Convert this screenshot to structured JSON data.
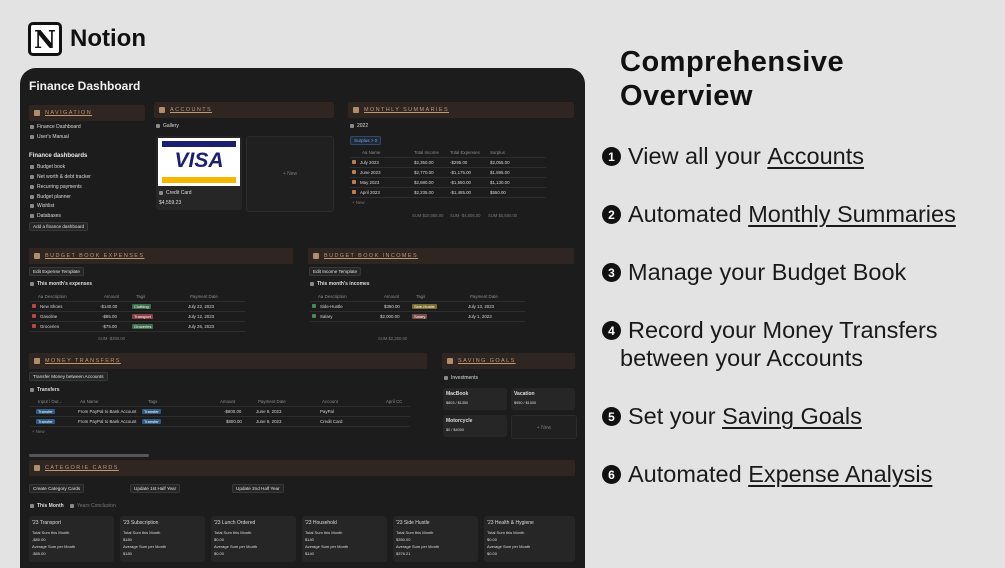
{
  "brand": {
    "logo_letter": "N",
    "name": "Notion"
  },
  "dashboard": {
    "title": "Finance Dashboard",
    "navigation": {
      "header": "NAVIGATION",
      "links": [
        "Finance Dashboard",
        "User's Manual"
      ],
      "group_title": "Finance dashboards",
      "items": [
        "Budget book",
        "Net worth & debt tracker",
        "Recurring payments",
        "Budget planner",
        "Wishlist",
        "Databases"
      ],
      "add_button": "Add a finance dashboard"
    },
    "accounts": {
      "header": "ACCOUNTS",
      "view": "Gallery",
      "card_logo": "VISA",
      "card_name": "Credit Card",
      "card_value": "$4,559.23",
      "new_label": "+ New"
    },
    "monthly": {
      "header": "MONTHLY SUMMARIES",
      "view": "2022",
      "filter": "Surplus > 0",
      "columns": [
        "Aa Name",
        "Total Income",
        "Total Expenses",
        "Surplus"
      ],
      "rows": [
        [
          "July 2023",
          "$2,350.00",
          "-$295.00",
          "$2,055.00"
        ],
        [
          "June 2023",
          "$2,770.00",
          "-$1,175.00",
          "$1,595.00"
        ],
        [
          "May 2023",
          "$2,680.00",
          "-$1,550.00",
          "$1,130.00"
        ],
        [
          "April 2023",
          "$2,235.00",
          "-$1,485.00",
          "$550.00"
        ]
      ],
      "new_label": "+ New",
      "sums": [
        "SUM $10,085.00",
        "SUM -$4,505.00",
        "SUM $5,580.00"
      ]
    },
    "expenses": {
      "header": "BUDGET BOOK EXPENSES",
      "template_button": "Edit Expense Template",
      "view": "This month's expenses",
      "columns": [
        "Aa Description",
        "Amount",
        "Tags",
        "Payment Date"
      ],
      "rows": [
        {
          "desc": "New Shoes",
          "amount": "-$140.00",
          "tag": "Clothing",
          "date": "July 22, 2023"
        },
        {
          "desc": "Gasoline",
          "amount": "-$85.00",
          "tag": "Transport",
          "date": "July 12, 2023"
        },
        {
          "desc": "Groceries",
          "amount": "-$75.00",
          "tag": "Groceries",
          "date": "July 26, 2023"
        }
      ],
      "sum": "SUM -$290.00",
      "tag_colors": [
        "#3d6b4e",
        "#8a4040",
        "#3d6b4e"
      ]
    },
    "incomes": {
      "header": "BUDGET BOOK INCOMES",
      "template_button": "Edit Income Template",
      "view": "This month's incomes",
      "columns": [
        "Aa Description",
        "Amount",
        "Tags",
        "Payment Date"
      ],
      "rows": [
        {
          "desc": "Side-Hustle",
          "amount": "$350.00",
          "tag": "Side-Hustle",
          "date": "July 13, 2023"
        },
        {
          "desc": "Salary",
          "amount": "$2,000.00",
          "tag": "Salary",
          "date": "July 1, 2023"
        }
      ],
      "sum": "SUM $2,350.00",
      "tag_colors": [
        "#7a6a2e",
        "#7a4a4a"
      ]
    },
    "transfers": {
      "header": "MONEY TRANSFERS",
      "button": "Transfer Money between Accounts",
      "view": "Transfers",
      "columns": [
        "Input / Out...",
        "Aa Name",
        "Tags",
        "Amount",
        "Payment Date",
        "Account",
        "April CC"
      ],
      "rows": [
        {
          "type": "Transfer",
          "name": "From PayPal to Bank Account",
          "tag": "Transfer",
          "amount": "-$800.00",
          "date": "June 9, 2023",
          "account": "PayPal"
        },
        {
          "type": "Transfer",
          "name": "From PayPal to Bank Account",
          "tag": "Transfer",
          "amount": "$800.00",
          "date": "June 9, 2023",
          "account": "Credit Card"
        }
      ],
      "new_label": "+ New"
    },
    "saving": {
      "header": "SAVING GOALS",
      "view": "Investments",
      "goals": [
        {
          "name": "MacBook",
          "progress": "$803 / $1350"
        },
        {
          "name": "Vacation",
          "progress": "$950 / $1000"
        },
        {
          "name": "Motorcycle",
          "progress": "$0 / $4000"
        }
      ],
      "new_label": "+ New"
    },
    "categories": {
      "header": "CATEGORIE CARDS",
      "buttons": [
        "Create Category Cards",
        "Update 1st Half Year",
        "Update 2nd Half Year"
      ],
      "tabs": [
        "This Month",
        "Years Conclusion"
      ],
      "cards": [
        {
          "title": "'23 Transport",
          "sum_label": "Total Sum this Month",
          "sum": "-$80.00",
          "avg_label": "Average Sum per Month",
          "avg": "-$85.00"
        },
        {
          "title": "'23 Subscription",
          "sum_label": "Total Sum this Month",
          "sum": "$180",
          "avg_label": "Average Sum per Month",
          "avg": "$180"
        },
        {
          "title": "'23 Lunch Ordered",
          "sum_label": "Total Sum this Month",
          "sum": "$0.00",
          "avg_label": "Average Sum per Month",
          "avg": "$0.00"
        },
        {
          "title": "'23 Household",
          "sum_label": "Total Sum this Month",
          "sum": "$140",
          "avg_label": "Average Sum per Month",
          "avg": "$140"
        },
        {
          "title": "'23 Side Hustle",
          "sum_label": "Total Sum this Month",
          "sum": "$350.00",
          "avg_label": "Average Sum per Month",
          "avg": "$376.21"
        },
        {
          "title": "'23 Health & Hygiene",
          "sum_label": "Total Sum this Month",
          "sum": "$0.00",
          "avg_label": "Average Sum per Month",
          "avg": "$0.00"
        }
      ]
    }
  },
  "overview": {
    "title_line1": "Comprehensive",
    "title_line2": "Overview",
    "features": [
      {
        "num": "1",
        "pre": "View all your ",
        "link": "Accounts",
        "post": ""
      },
      {
        "num": "2",
        "pre": "Automated ",
        "link": "Monthly Summaries",
        "post": ""
      },
      {
        "num": "3",
        "pre": "Manage your Budget Book",
        "link": "",
        "post": ""
      },
      {
        "num": "4",
        "pre": "Record your Money Transfers",
        "link": "",
        "post": "",
        "line2": "between your Accounts"
      },
      {
        "num": "5",
        "pre": "Set your ",
        "link": "Saving Goals",
        "post": ""
      },
      {
        "num": "6",
        "pre": "Automated ",
        "link": "Expense Analysis",
        "post": ""
      }
    ]
  }
}
